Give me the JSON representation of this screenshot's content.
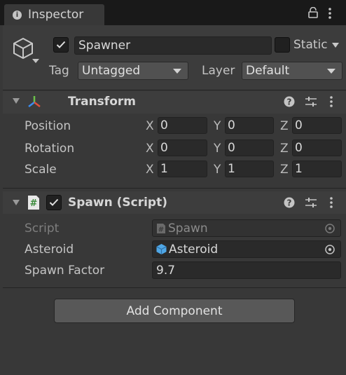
{
  "tab": {
    "title": "Inspector",
    "icon": "info-icon"
  },
  "header": {
    "active": true,
    "object_name": "Spawner",
    "static_label": "Static",
    "static_checked": false,
    "tag_label": "Tag",
    "tag_value": "Untagged",
    "layer_label": "Layer",
    "layer_value": "Default",
    "object_icon": "cube-icon"
  },
  "transform": {
    "title": "Transform",
    "rows": [
      {
        "label": "Position",
        "x": "0",
        "y": "0",
        "z": "0"
      },
      {
        "label": "Rotation",
        "x": "0",
        "y": "0",
        "z": "0"
      },
      {
        "label": "Scale",
        "x": "1",
        "y": "1",
        "z": "1"
      }
    ],
    "axes": {
      "x": "X",
      "y": "Y",
      "z": "Z"
    }
  },
  "spawn": {
    "title": "Spawn (Script)",
    "enabled": true,
    "script_label": "Script",
    "script_value": "Spawn",
    "asteroid_label": "Asteroid",
    "asteroid_value": "Asteroid",
    "factor_label": "Spawn Factor",
    "factor_value": "9.7"
  },
  "add_component_label": "Add Component",
  "colors": {
    "panel": "#383838",
    "field": "#2a2a2a",
    "header": "#3d3d3d",
    "asset_blue": "#4fa7e6"
  }
}
